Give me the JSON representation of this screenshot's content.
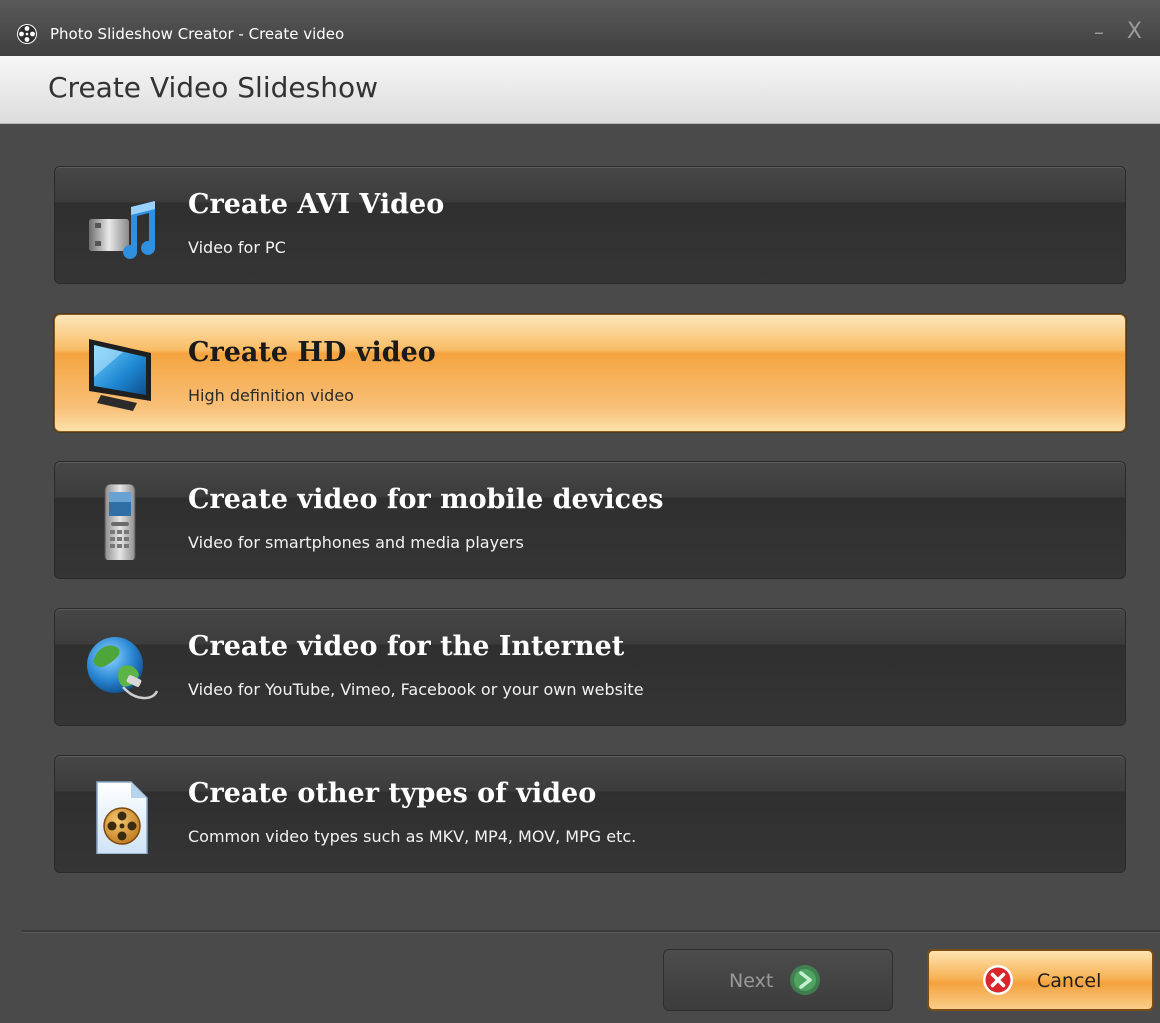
{
  "window": {
    "title": "Photo Slideshow Creator - Create video",
    "app_icon": "film-reel-icon",
    "minimize_glyph": "–",
    "close_glyph": "X"
  },
  "header": {
    "title": "Create Video Slideshow"
  },
  "options": [
    {
      "title": "Create AVI Video",
      "subtitle": "Video for PC",
      "icon": "film-music-icon",
      "selected": false
    },
    {
      "title": "Create HD video",
      "subtitle": "High definition video",
      "icon": "monitor-icon",
      "selected": true
    },
    {
      "title": "Create video for mobile devices",
      "subtitle": "Video for smartphones and media players",
      "icon": "mobile-phone-icon",
      "selected": false
    },
    {
      "title": "Create video for the Internet",
      "subtitle": "Video for YouTube, Vimeo, Facebook or your own website",
      "icon": "globe-icon",
      "selected": false
    },
    {
      "title": "Create other types of video",
      "subtitle": "Common video types such as MKV, MP4, MOV, MPG etc.",
      "icon": "video-file-icon",
      "selected": false
    }
  ],
  "footer": {
    "next_label": "Next",
    "cancel_label": "Cancel"
  },
  "colors": {
    "window_bg": "#4a4a4a",
    "accent_orange": "#f4a440",
    "header_bg": "#e8e8e8",
    "next_arrow": "#3fae5a",
    "cancel_x": "#d8262c"
  }
}
